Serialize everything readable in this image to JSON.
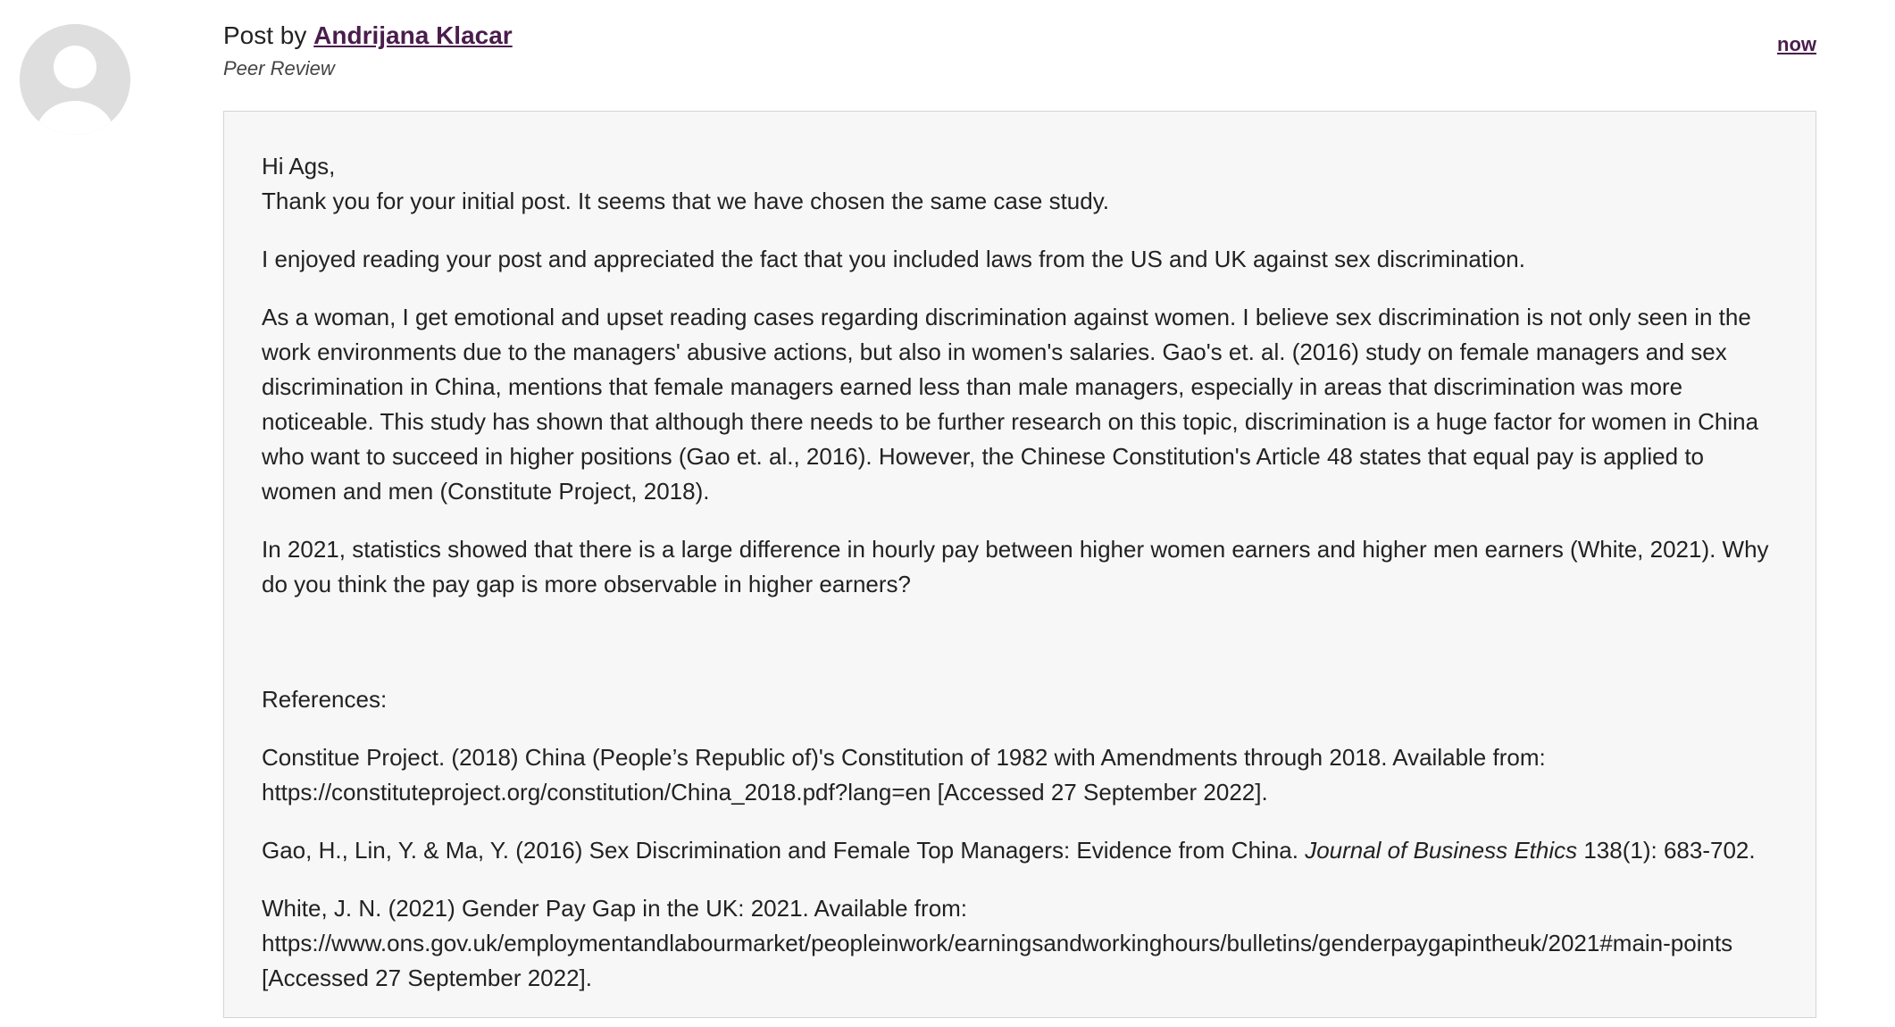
{
  "post": {
    "byline_prefix": "Post by",
    "author": "Andrijana Klacar",
    "role": "Peer Review",
    "timestamp": "now"
  },
  "body": {
    "greeting": "Hi Ags,",
    "paragraphs": [
      "Thank you for your initial post. It seems that we have chosen the same case study.",
      "I enjoyed reading your post and appreciated the fact that you included laws from the US and UK against sex discrimination.",
      "As a woman, I get emotional and upset reading cases regarding discrimination against women. I believe sex discrimination is not only seen in the work environments due to the managers' abusive actions, but also in women's salaries. Gao's et. al. (2016) study on female managers and sex discrimination in China, mentions that female managers earned less than male managers, especially in areas that discrimination was more noticeable. This study has shown that although there needs to be further research on this topic, discrimination is a huge factor for women in China who want to succeed in higher positions (Gao et. al., 2016). However, the Chinese Constitution's Article 48 states that equal pay is applied to women and men (Constitute Project, 2018).",
      "In 2021, statistics showed that there is a large difference in hourly pay between higher women earners and higher men earners (White, 2021). Why do you think the pay gap is more observable in higher earners?"
    ],
    "references_heading": "References:",
    "references": {
      "ref1": "Constitue Project. (2018) China (People’s Republic of)'s Constitution of 1982 with Amendments through 2018. Available from: https://constituteproject.org/constitution/China_2018.pdf?lang=en [Accessed 27 September 2022].",
      "ref2_before": "Gao, H., Lin, Y. & Ma, Y. (2016) Sex Discrimination and Female Top Managers: Evidence from China. ",
      "ref2_journal": "Journal of Business Ethics",
      "ref2_after": " 138(1): 683-702.",
      "ref3": "White, J. N. (2021) Gender Pay Gap in the UK: 2021. Available from: https://www.ons.gov.uk/employmentandlabourmarket/peopleinwork/earningsandworkinghours/bulletins/genderpaygapintheuk/2021#main-points [Accessed 27 September 2022]."
    }
  },
  "colors": {
    "link": "#4a1d4c",
    "box_background": "#f7f7f7",
    "box_border": "#d4d4d4",
    "avatar": "#dedede"
  },
  "icons": {
    "avatar": "default-user-avatar-icon"
  }
}
